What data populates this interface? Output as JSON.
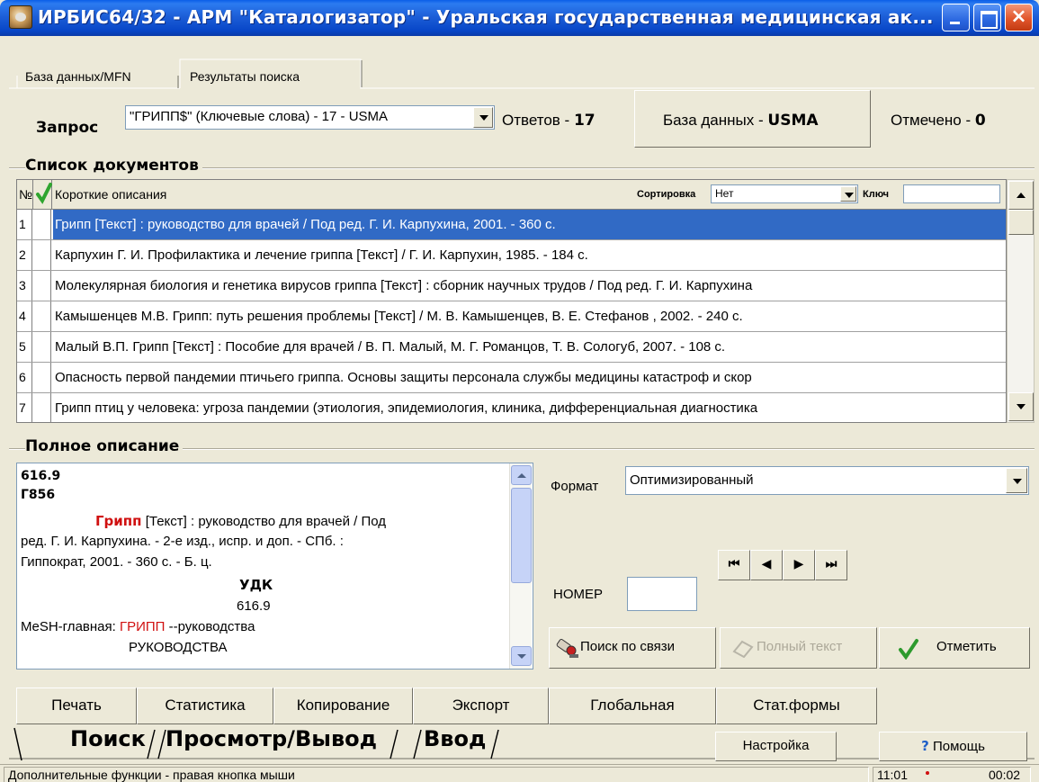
{
  "window": {
    "title": "ИРБИС64/32 - АРМ \"Каталогизатор\" - Уральская государственная медицинская ак...",
    "close_glyph": "×"
  },
  "tabs": [
    {
      "label": "База данных/MFN"
    },
    {
      "label": "Результаты поиска"
    }
  ],
  "query": {
    "label": "Запрос",
    "value": "\"ГРИПП$\" (Ключевые слова) - 17 - USMA",
    "answers_label": "Ответов -",
    "answers_count": "17",
    "db_label": "База данных -",
    "db_name": "USMA",
    "marked_label": "Отмечено -",
    "marked_count": "0"
  },
  "doc_list": {
    "title": "Список документов",
    "col_num": "№",
    "col_desc": "Короткие описания",
    "sort_label": "Сортировка",
    "sort_value": "Нет",
    "key_label": "Ключ",
    "key_value": "",
    "selected_index": 0,
    "rows": [
      {
        "num": "1",
        "desc": "Грипп [Текст] : руководство для врачей / Под ред. Г. И. Карпухина, 2001. - 360 с."
      },
      {
        "num": "2",
        "desc": "Карпухин Г. И. Профилактика и лечение гриппа [Текст] / Г. И. Карпухин, 1985. - 184 с."
      },
      {
        "num": "3",
        "desc": "Молекулярная биология и генетика вирусов гриппа [Текст] : сборник научных трудов / Под ред. Г. И. Карпухина"
      },
      {
        "num": "4",
        "desc": "Камышенцев М.В. Грипп: путь решения проблемы [Текст] / М. В. Камышенцев, В. Е. Стефанов , 2002. - 240 с."
      },
      {
        "num": "5",
        "desc": "Малый В.П. Грипп [Текст] : Пособие для врачей / В. П. Малый, М. Г. Романцов, Т. В. Сологуб, 2007. - 108 с."
      },
      {
        "num": "6",
        "desc": "Опасность первой пандемии птичьего гриппа. Основы защиты персонала службы медицины катастроф и скор"
      },
      {
        "num": "7",
        "desc": "Грипп птиц у человека: угроза пандемии (этиология, эпидемиология, клиника, дифференциальная диагностика"
      }
    ]
  },
  "full_desc": {
    "title": "Полное описание",
    "udc_top": "616.9",
    "author_mark": "Г856",
    "line1_red": "Грипп",
    "line1_rest": " [Текст] : руководство для врачей / Под",
    "line2": "ред. Г. И. Карпухина. - 2-е изд., испр. и доп. - СПб. :",
    "line3": "Гиппократ, 2001. - 360 с. - Б. ц.",
    "udk_label": "УДК",
    "udk_value": "616.9",
    "mesh_label": "MeSH-главная: ",
    "mesh_red": "ГРИПП",
    "mesh_rest": " --руководства",
    "mesh_sub": "РУКОВОДСТВА"
  },
  "format": {
    "label": "Формат",
    "value": "Оптимизированный"
  },
  "nomer": {
    "label": "НОМЕР",
    "value": ""
  },
  "nav_buttons": [
    "⏮",
    "◀",
    "▶",
    "⏭"
  ],
  "actions": {
    "link_search": "Поиск по связи",
    "full_text": "Полный текст",
    "mark": "Отметить"
  },
  "function_buttons": [
    "Печать",
    "Статистика",
    "Копирование",
    "Экспорт",
    "Глобальная",
    "Стат.формы"
  ],
  "modes": {
    "search": "Поиск",
    "view": "Просмотр/Вывод",
    "input": "Ввод",
    "settings": "Настройка",
    "help": "Помощь"
  },
  "status": {
    "hint": "Дополнительные функции - правая кнопка мыши",
    "time": "11:01",
    "elapsed": "00:02"
  },
  "colors": {
    "accent_red": "#d01010",
    "selection": "#316ac5",
    "titlebar": "#0846c8"
  }
}
